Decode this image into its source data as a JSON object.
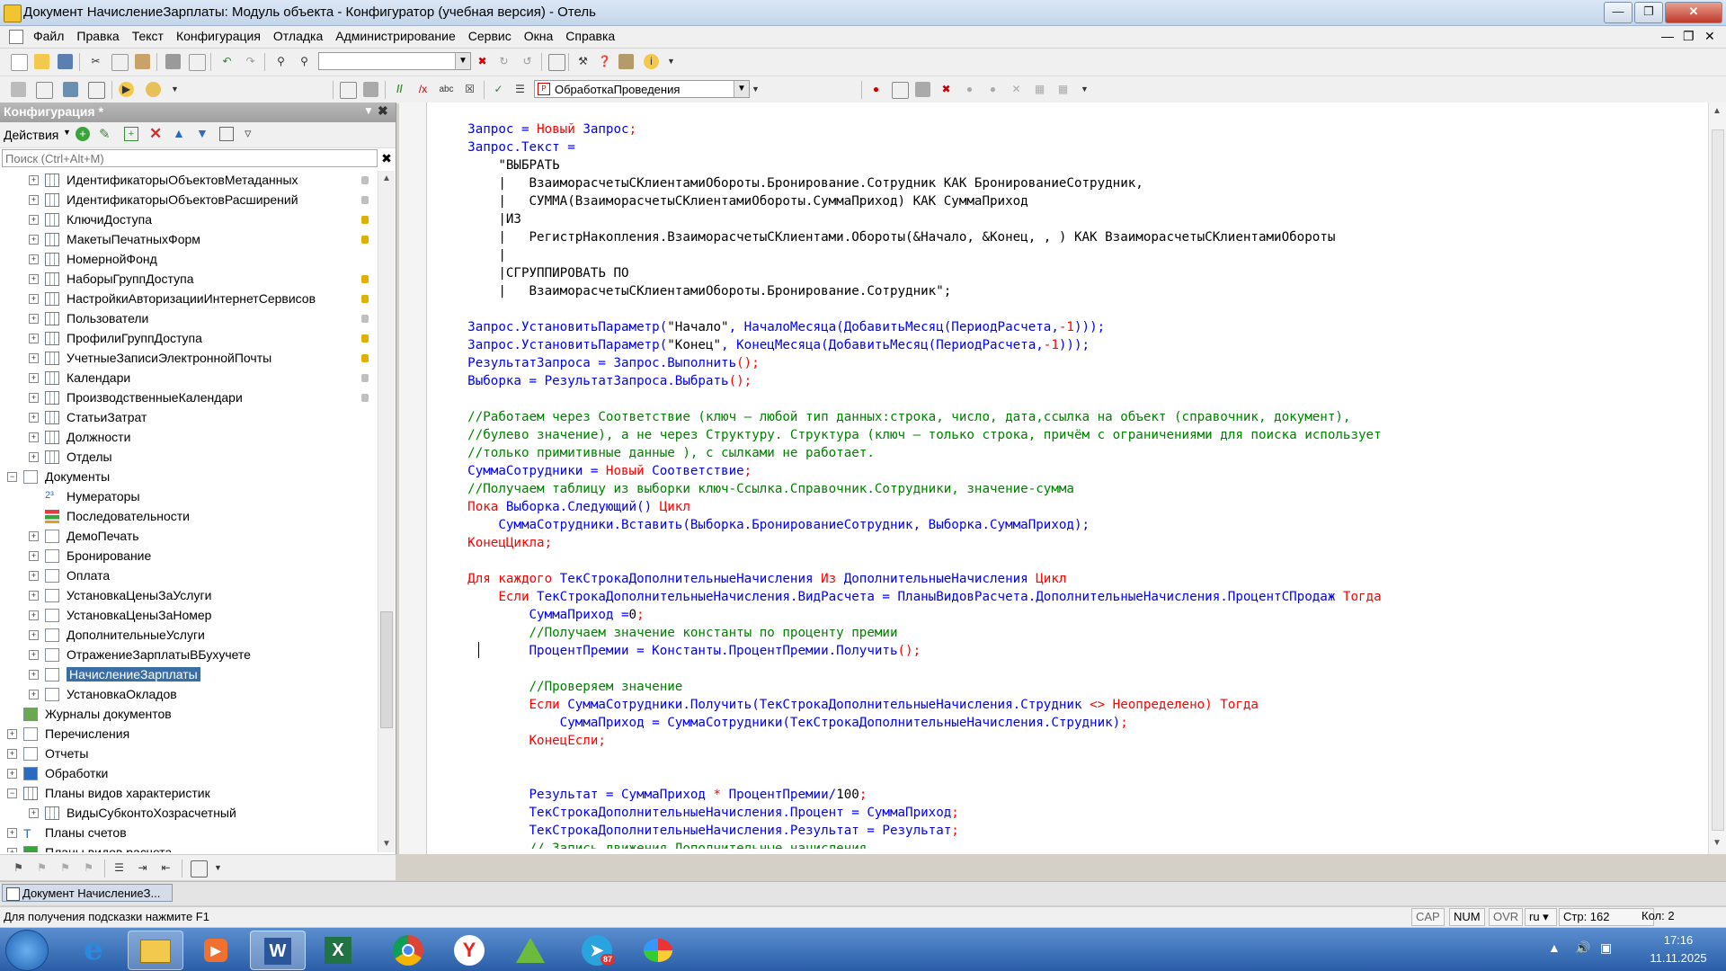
{
  "window": {
    "title": "Документ НачислениеЗарплаты: Модуль объекта - Конфигуратор (учебная версия) - Отель"
  },
  "menu": [
    "Файл",
    "Правка",
    "Текст",
    "Конфигурация",
    "Отладка",
    "Администрирование",
    "Сервис",
    "Окна",
    "Справка"
  ],
  "toolbar2": {
    "procedure_combo": "ОбработкаПроведения"
  },
  "left_panel": {
    "title": "Конфигурация *",
    "actions_label": "Действия",
    "search_placeholder": "Поиск (Ctrl+Alt+M)",
    "tree": [
      {
        "label": "ИдентификаторыОбъектовМетаданных",
        "level": 2,
        "icon": "grid",
        "lock": "g"
      },
      {
        "label": "ИдентификаторыОбъектовРасширений",
        "level": 2,
        "icon": "grid",
        "lock": "g"
      },
      {
        "label": "КлючиДоступа",
        "level": 2,
        "icon": "grid",
        "lock": "y"
      },
      {
        "label": "МакетыПечатныхФорм",
        "level": 2,
        "icon": "grid",
        "lock": "y"
      },
      {
        "label": "НомернойФонд",
        "level": 2,
        "icon": "grid",
        "lock": ""
      },
      {
        "label": "НаборыГруппДоступа",
        "level": 2,
        "icon": "grid",
        "lock": "y"
      },
      {
        "label": "НастройкиАвторизацииИнтернетСервисов",
        "level": 2,
        "icon": "grid",
        "lock": "y"
      },
      {
        "label": "Пользователи",
        "level": 2,
        "icon": "grid",
        "lock": "g"
      },
      {
        "label": "ПрофилиГруппДоступа",
        "level": 2,
        "icon": "grid",
        "lock": "y"
      },
      {
        "label": "УчетныеЗаписиЭлектроннойПочты",
        "level": 2,
        "icon": "grid",
        "lock": "y"
      },
      {
        "label": "Календари",
        "level": 2,
        "icon": "grid",
        "lock": "g"
      },
      {
        "label": "ПроизводственныеКалендари",
        "level": 2,
        "icon": "grid",
        "lock": "g"
      },
      {
        "label": "СтатьиЗатрат",
        "level": 2,
        "icon": "grid",
        "lock": ""
      },
      {
        "label": "Должности",
        "level": 2,
        "icon": "grid",
        "lock": ""
      },
      {
        "label": "Отделы",
        "level": 2,
        "icon": "grid",
        "lock": ""
      },
      {
        "label": "Документы",
        "level": 1,
        "icon": "doc",
        "lock": "",
        "expanded": true
      },
      {
        "label": "Нумераторы",
        "level": 2,
        "icon": "num",
        "lock": "",
        "noexp": true
      },
      {
        "label": "Последовательности",
        "level": 2,
        "icon": "seq",
        "lock": "",
        "noexp": true
      },
      {
        "label": "ДемоПечать",
        "level": 2,
        "icon": "doc",
        "lock": ""
      },
      {
        "label": "Бронирование",
        "level": 2,
        "icon": "doc",
        "lock": ""
      },
      {
        "label": "Оплата",
        "level": 2,
        "icon": "doc",
        "lock": ""
      },
      {
        "label": "УстановкаЦеныЗаУслуги",
        "level": 2,
        "icon": "doc",
        "lock": ""
      },
      {
        "label": "УстановкаЦеныЗаНомер",
        "level": 2,
        "icon": "doc",
        "lock": ""
      },
      {
        "label": "ДополнительныеУслуги",
        "level": 2,
        "icon": "doc",
        "lock": ""
      },
      {
        "label": "ОтражениеЗарплатыВБухучете",
        "level": 2,
        "icon": "doc",
        "lock": ""
      },
      {
        "label": "НачислениеЗарплаты",
        "level": 2,
        "icon": "doc",
        "lock": "",
        "selected": true
      },
      {
        "label": "УстановкаОкладов",
        "level": 2,
        "icon": "doc",
        "lock": ""
      },
      {
        "label": "Журналы документов",
        "level": 1,
        "icon": "journal",
        "lock": "",
        "noexp": true
      },
      {
        "label": "Перечисления",
        "level": 1,
        "icon": "enum",
        "lock": ""
      },
      {
        "label": "Отчеты",
        "level": 1,
        "icon": "doc",
        "lock": ""
      },
      {
        "label": "Обработки",
        "level": 1,
        "icon": "proc",
        "lock": ""
      },
      {
        "label": "Планы видов характеристик",
        "level": 1,
        "icon": "grid",
        "lock": "",
        "expanded": true
      },
      {
        "label": "ВидыСубконтоХозрасчетный",
        "level": 2,
        "icon": "grid",
        "lock": ""
      },
      {
        "label": "Планы счетов",
        "level": 1,
        "icon": "acc",
        "lock": ""
      },
      {
        "label": "Планы видов расчета",
        "level": 1,
        "icon": "calc",
        "lock": ""
      }
    ]
  },
  "code": [
    [
      [
        "id",
        "    Запрос "
      ],
      [
        "id",
        "= "
      ],
      [
        "kw",
        "Новый "
      ],
      [
        "id",
        "Запрос"
      ],
      [
        "kw",
        ";"
      ]
    ],
    [
      [
        "id",
        "    Запрос.Текст ="
      ]
    ],
    [
      [
        "str",
        "        \"ВЫБРАТЬ"
      ]
    ],
    [
      [
        "str",
        "        |   ВзаиморасчетыСКлиентамиОбороты.Бронирование.Сотрудник КАК БронированиеСотрудник,"
      ]
    ],
    [
      [
        "str",
        "        |   СУММА(ВзаиморасчетыСКлиентамиОбороты.СуммаПриход) КАК СуммаПриход"
      ]
    ],
    [
      [
        "str",
        "        |ИЗ"
      ]
    ],
    [
      [
        "str",
        "        |   РегистрНакопления.ВзаиморасчетыСКлиентами.Обороты(&Начало, &Конец, , ) КАК ВзаиморасчетыСКлиентамиОбороты"
      ]
    ],
    [
      [
        "str",
        "        |"
      ]
    ],
    [
      [
        "str",
        "        |СГРУППИРОВАТЬ ПО"
      ]
    ],
    [
      [
        "str",
        "        |   ВзаиморасчетыСКлиентамиОбороты.Бронирование.Сотрудник\";"
      ]
    ],
    [
      [
        "str",
        ""
      ]
    ],
    [
      [
        "id",
        "    Запрос.УстановитьПараметр("
      ],
      [
        "str",
        "\"Начало\""
      ],
      [
        "id",
        ", НачалоМесяца(ДобавитьМесяц(ПериодРасчета,"
      ],
      [
        "kw",
        "-1"
      ],
      [
        "id",
        ")));"
      ]
    ],
    [
      [
        "id",
        "    Запрос.УстановитьПараметр("
      ],
      [
        "str",
        "\"Конец\""
      ],
      [
        "id",
        ", КонецМесяца(ДобавитьМесяц(ПериодРасчета,"
      ],
      [
        "kw",
        "-1"
      ],
      [
        "id",
        ")));"
      ]
    ],
    [
      [
        "id",
        "    РезультатЗапроса = Запрос.Выполнить"
      ],
      [
        "kw",
        "();"
      ]
    ],
    [
      [
        "id",
        "    Выборка = РезультатЗапроса.Выбрать"
      ],
      [
        "kw",
        "();"
      ]
    ],
    [
      [
        "str",
        ""
      ]
    ],
    [
      [
        "cm",
        "    //Работаем через Соответствие (ключ — любой тип данных:строка, число, дата,ссылка на объект (справочник, документ),"
      ]
    ],
    [
      [
        "cm",
        "    //булево значение), а не через Структуру. Структура (ключ — только строка, причём с ограничениями для поиска использует"
      ]
    ],
    [
      [
        "cm",
        "    //только примитивные данные ), с сылками не работает."
      ]
    ],
    [
      [
        "id",
        "    СуммаСотрудники = "
      ],
      [
        "kw",
        "Новый "
      ],
      [
        "id",
        "Соответствие"
      ],
      [
        "kw",
        ";"
      ]
    ],
    [
      [
        "cm",
        "    //Получаем таблицу из выборки ключ-Ссылка.Справочник.Сотрудники, значение-сумма"
      ]
    ],
    [
      [
        "kw",
        "    Пока "
      ],
      [
        "id",
        "Выборка.Следующий() "
      ],
      [
        "kw",
        "Цикл"
      ]
    ],
    [
      [
        "id",
        "        СуммаСотрудники.Вставить(Выборка.БронированиеСотрудник, Выборка.СуммаПриход);"
      ]
    ],
    [
      [
        "kw",
        "    КонецЦикла;"
      ]
    ],
    [
      [
        "str",
        ""
      ]
    ],
    [
      [
        "kw",
        "    Для каждого "
      ],
      [
        "id",
        "ТекСтрокаДополнительныеНачисления "
      ],
      [
        "kw",
        "Из "
      ],
      [
        "id",
        "ДополнительныеНачисления "
      ],
      [
        "kw",
        "Цикл"
      ]
    ],
    [
      [
        "kw",
        "        Если "
      ],
      [
        "id",
        "ТекСтрокаДополнительныеНачисления.ВидРасчета = ПланыВидовРасчета.ДополнительныеНачисления.ПроцентСПродаж "
      ],
      [
        "kw",
        "Тогда"
      ]
    ],
    [
      [
        "id",
        "            СуммаПриход ="
      ],
      [
        "str",
        "0"
      ],
      [
        "kw",
        ";"
      ]
    ],
    [
      [
        "cm",
        "            //Получаем значение константы по проценту премии"
      ]
    ],
    [
      [
        "id",
        "            ПроцентПремии = Константы.ПроцентПремии.Получить"
      ],
      [
        "kw",
        "();"
      ]
    ],
    [
      [
        "str",
        ""
      ]
    ],
    [
      [
        "cm",
        "            //Проверяем значение"
      ]
    ],
    [
      [
        "kw",
        "            Если "
      ],
      [
        "id",
        "СуммаСотрудники.Получить(ТекСтрокаДополнительныеНачисления.Струдник "
      ],
      [
        "kw",
        "<> Неопределено) Тогда"
      ]
    ],
    [
      [
        "id",
        "                СуммаПриход = СуммаСотрудники(ТекСтрокаДополнительныеНачисления.Струдник)"
      ],
      [
        "kw",
        ";"
      ]
    ],
    [
      [
        "kw",
        "            КонецЕсли;"
      ]
    ],
    [
      [
        "str",
        ""
      ]
    ],
    [
      [
        "str",
        ""
      ]
    ],
    [
      [
        "id",
        "            Результат = СуммаПриход "
      ],
      [
        "kw",
        "* "
      ],
      [
        "id",
        "ПроцентПремии/"
      ],
      [
        "str",
        "100"
      ],
      [
        "kw",
        ";"
      ]
    ],
    [
      [
        "id",
        "            ТекСтрокаДополнительныеНачисления.Процент = СуммаПриход"
      ],
      [
        "kw",
        ";"
      ]
    ],
    [
      [
        "id",
        "            ТекСтрокаДополнительныеНачисления.Результат = Результат"
      ],
      [
        "kw",
        ";"
      ]
    ],
    [
      [
        "cm",
        "            // Запись движения Дополнительные начисления"
      ]
    ]
  ],
  "bottom": {
    "doc_tab": "Документ НачислениеЗ..."
  },
  "status": {
    "hint": "Для получения подсказки нажмите F1",
    "cap": "CAP",
    "num": "NUM",
    "ovr": "OVR",
    "lang": "ru",
    "line": "Стр: 162",
    "col": "Кол: 2"
  },
  "taskbar": {
    "time": "17:16",
    "date": "11.11.2025",
    "telegram_badge": "87"
  }
}
